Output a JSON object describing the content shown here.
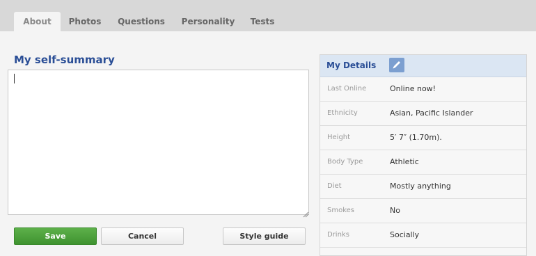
{
  "tabs": [
    {
      "label": "About"
    },
    {
      "label": "Photos"
    },
    {
      "label": "Questions"
    },
    {
      "label": "Personality"
    },
    {
      "label": "Tests"
    }
  ],
  "summary": {
    "title": "My self-summary",
    "value": ""
  },
  "buttons": {
    "save": "Save",
    "cancel": "Cancel",
    "style_guide": "Style guide"
  },
  "details": {
    "title": "My Details",
    "rows": [
      {
        "label": "Last Online",
        "value": "Online now!"
      },
      {
        "label": "Ethnicity",
        "value": "Asian, Pacific Islander"
      },
      {
        "label": "Height",
        "value": "5′ 7″ (1.70m)."
      },
      {
        "label": "Body Type",
        "value": "Athletic"
      },
      {
        "label": "Diet",
        "value": "Mostly anything"
      },
      {
        "label": "Smokes",
        "value": "No"
      },
      {
        "label": "Drinks",
        "value": "Socially"
      }
    ]
  },
  "icons": {
    "edit": "pencil-icon",
    "grip": "resize-grip-icon"
  },
  "colors": {
    "accent": "#2a4e96",
    "save": "#4aa33a",
    "header_bg": "#dbe6f3"
  }
}
